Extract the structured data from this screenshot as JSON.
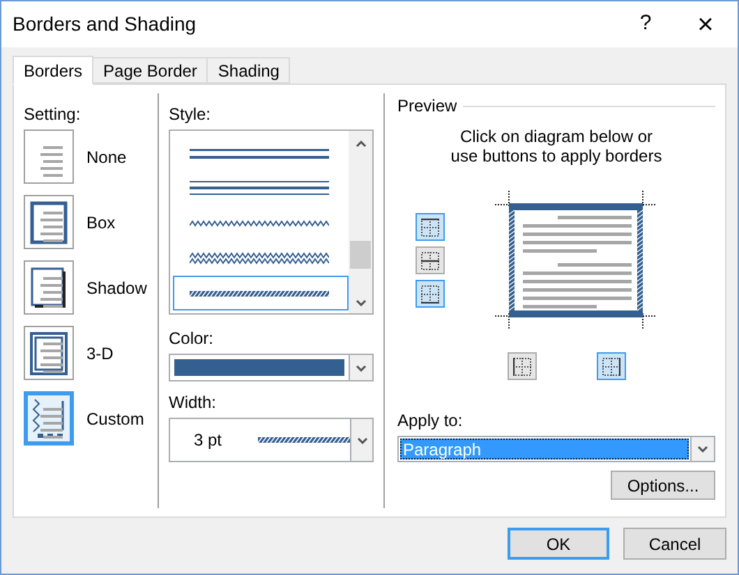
{
  "window": {
    "title": "Borders and Shading",
    "help": "?",
    "close": "×"
  },
  "tabs": [
    {
      "label": "Borders",
      "selected": true
    },
    {
      "label": "Page Border",
      "selected": false
    },
    {
      "label": "Shading",
      "selected": false
    }
  ],
  "setting": {
    "label": "Setting:",
    "items": [
      {
        "label": "None",
        "kind": "none",
        "selected": false
      },
      {
        "label": "Box",
        "kind": "box",
        "selected": false
      },
      {
        "label": "Shadow",
        "kind": "shadow",
        "selected": false
      },
      {
        "label": "3-D",
        "kind": "raised",
        "selected": false
      },
      {
        "label": "Custom",
        "kind": "custom",
        "selected": true
      }
    ]
  },
  "style": {
    "label": "Style:",
    "items": [
      {
        "kind": "double",
        "selected": false
      },
      {
        "kind": "triple",
        "selected": false
      },
      {
        "kind": "wavy",
        "selected": false
      },
      {
        "kind": "double-wavy",
        "selected": false
      },
      {
        "kind": "hatched",
        "selected": true
      }
    ]
  },
  "color_field": {
    "label": "Color:",
    "color": "#345f91"
  },
  "width_field": {
    "label": "Width:",
    "value": "3 pt"
  },
  "preview": {
    "title": "Preview",
    "instruction": "Click on diagram below or\nuse buttons to apply borders",
    "side_buttons": [
      {
        "kind": "top",
        "selected": true
      },
      {
        "kind": "middle",
        "selected": false
      },
      {
        "kind": "bottom",
        "selected": true
      }
    ],
    "bottom_buttons": [
      {
        "kind": "left",
        "selected": false
      },
      {
        "kind": "right",
        "selected": true
      }
    ]
  },
  "apply_to": {
    "label": "Apply to:",
    "value": "Paragraph"
  },
  "buttons": {
    "options": "Options...",
    "ok": "OK",
    "cancel": "Cancel"
  }
}
